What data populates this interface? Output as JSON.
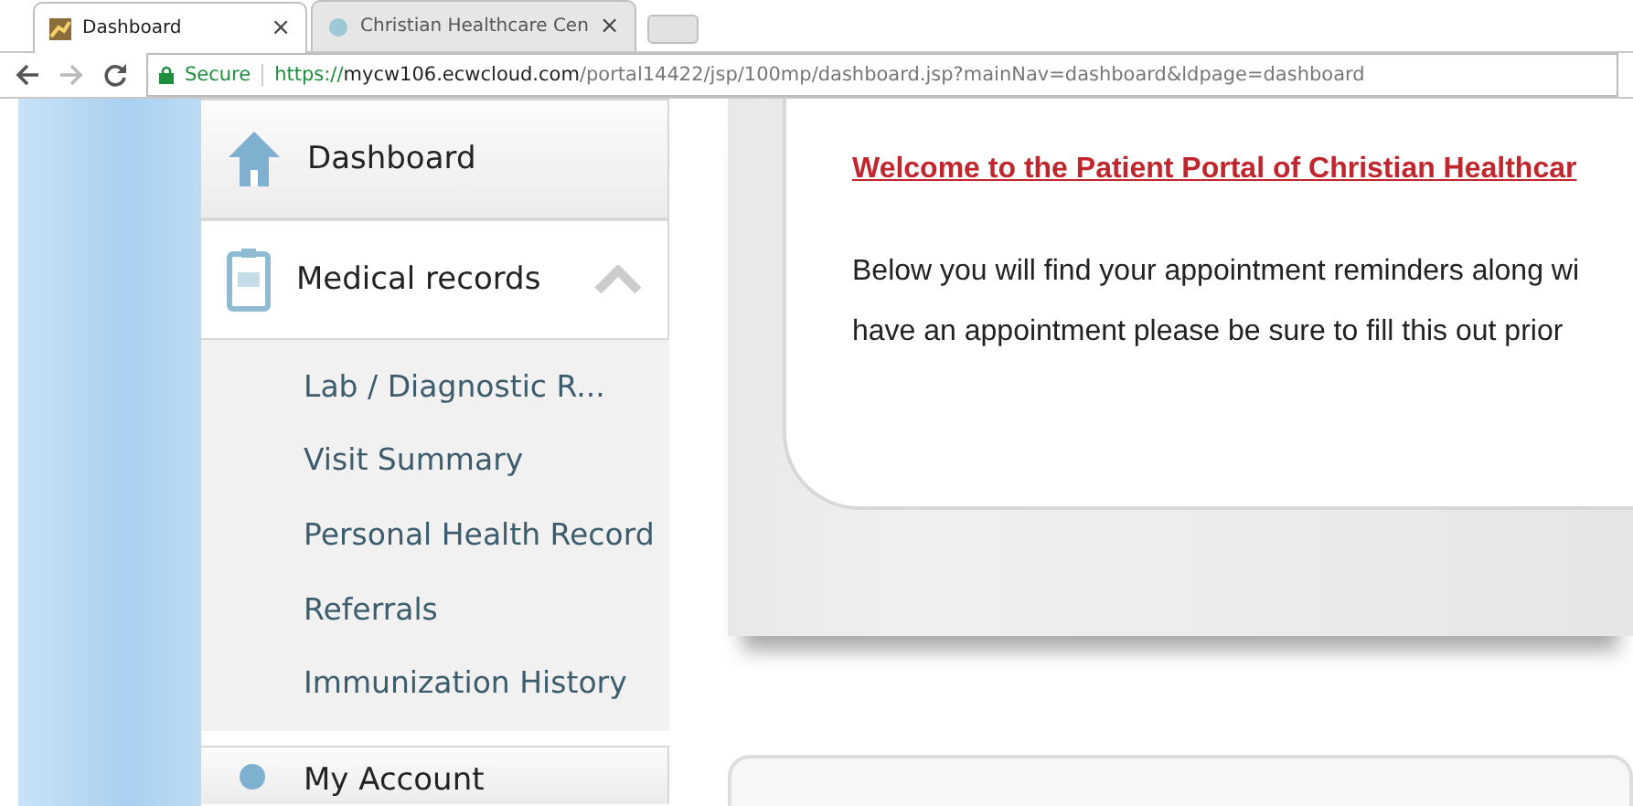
{
  "browser": {
    "tabs": [
      {
        "title": "Dashboard",
        "selected": true,
        "close": "×"
      },
      {
        "title": "Christian Healthcare Cen",
        "selected": false,
        "close": "×"
      }
    ],
    "address_bar": {
      "secure_label": "Secure",
      "url_scheme": "https://",
      "url_host": "mycw106.ecwcloud.com",
      "url_path": "/portal14422/jsp/100mp/dashboard.jsp?mainNav=dashboard&ldpage=dashboard"
    }
  },
  "sidebar": {
    "items": [
      {
        "label": "Dashboard",
        "selected": false
      },
      {
        "label": "Medical records",
        "selected": false,
        "expanded": true,
        "children": [
          {
            "label": "Lab / Diagnostic R..."
          },
          {
            "label": "Visit Summary"
          },
          {
            "label": "Personal Health Record"
          },
          {
            "label": "Referrals"
          },
          {
            "label": "Immunization History"
          }
        ]
      },
      {
        "label": "My Account",
        "selected": false
      }
    ]
  },
  "welcome": {
    "heading": "Welcome to the Patient Portal of Christian Healthcar",
    "lines": [
      "Below you will find your appointment reminders along wi",
      "have an appointment please be sure to fill this out prior"
    ]
  }
}
